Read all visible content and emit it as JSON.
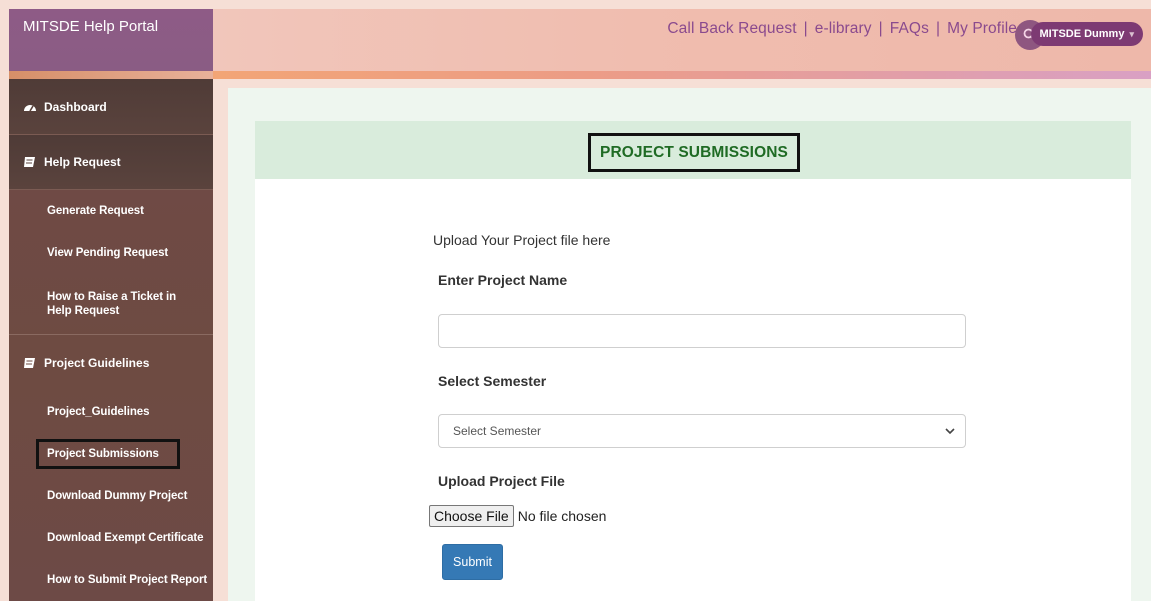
{
  "brand": {
    "title": "MITSDE Help Portal"
  },
  "header": {
    "links": [
      "Call Back Request",
      "e-library",
      "FAQs",
      "My Profile"
    ],
    "separator": "|",
    "user_name": "MITSDE Dummy",
    "search_icon": "search-icon",
    "accent_color": "#8a4a8e"
  },
  "sidebar": {
    "dashboard": "Dashboard",
    "help_request": {
      "label": "Help Request",
      "items": [
        "Generate Request",
        "View Pending Request",
        "How to Raise a Ticket in Help Request"
      ]
    },
    "project_guidelines": {
      "label": "Project Guidelines",
      "items": [
        "Project_Guidelines",
        "Project Submissions",
        "Download Dummy Project",
        "Download Exempt Certificate",
        "How to Submit Project Report"
      ]
    }
  },
  "main": {
    "panel_title": "PROJECT SUBMISSIONS",
    "intro": "Upload Your Project file here",
    "project_name_label": "Enter Project Name",
    "project_name_value": "",
    "semester_label": "Select Semester",
    "semester_selected": "Select Semester",
    "upload_label": "Upload Project File",
    "choose_file_label": "Choose File",
    "no_file_text": "No file chosen",
    "submit_label": "Submit",
    "title_color": "#1f6b24",
    "submit_color": "#3579b5"
  }
}
